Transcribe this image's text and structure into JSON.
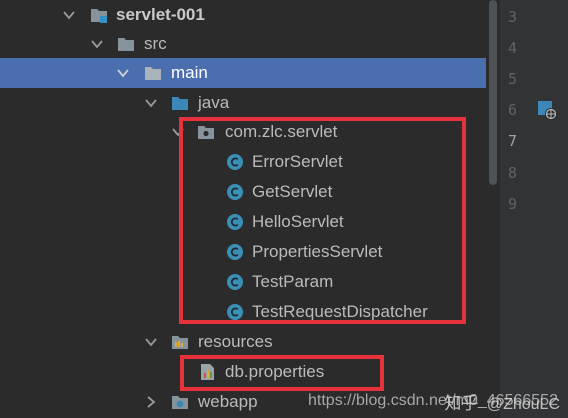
{
  "tree": {
    "project": "servlet-001",
    "src": "src",
    "main": "main",
    "java": "java",
    "package": "com.zlc.servlet",
    "classes": [
      "ErrorServlet",
      "GetServlet",
      "HelloServlet",
      "PropertiesServlet",
      "TestParam",
      "TestRequestDispatcher"
    ],
    "resources": "resources",
    "db_file": "db.properties",
    "webapp": "webapp"
  },
  "gutter": {
    "lines": [
      "3",
      "4",
      "5",
      "6",
      "7",
      "8",
      "9"
    ]
  },
  "watermark": {
    "url": "https://blog.csdn.net/m0_46566552",
    "zhihu": "知乎",
    "author": "@ZhouLC"
  },
  "colors": {
    "background": "#2b2b2b",
    "gutter": "#313335",
    "selection": "#4b6eaf",
    "highlight_box": "#e8323b",
    "class_icon": "#3a8fb5",
    "folder": "#87939a"
  }
}
